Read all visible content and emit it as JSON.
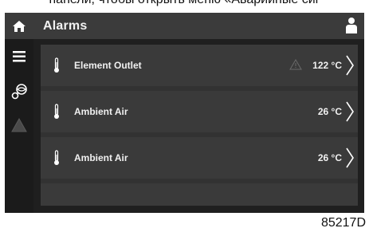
{
  "caption": "панели, чтобы открыть меню «Аварийные сиг",
  "header": {
    "title": "Alarms"
  },
  "rows": [
    {
      "label": "Element Outlet",
      "value": "122",
      "unit": "°C",
      "warning": true
    },
    {
      "label": "Ambient Air",
      "value": "26",
      "unit": "°C",
      "warning": false
    },
    {
      "label": "Ambient Air",
      "value": "26",
      "unit": "°C",
      "warning": false
    }
  ],
  "sidebar": {
    "items": [
      "home-icon",
      "menu-icon",
      "compressor-icon",
      "warning-icon"
    ]
  },
  "reference": "85217D"
}
